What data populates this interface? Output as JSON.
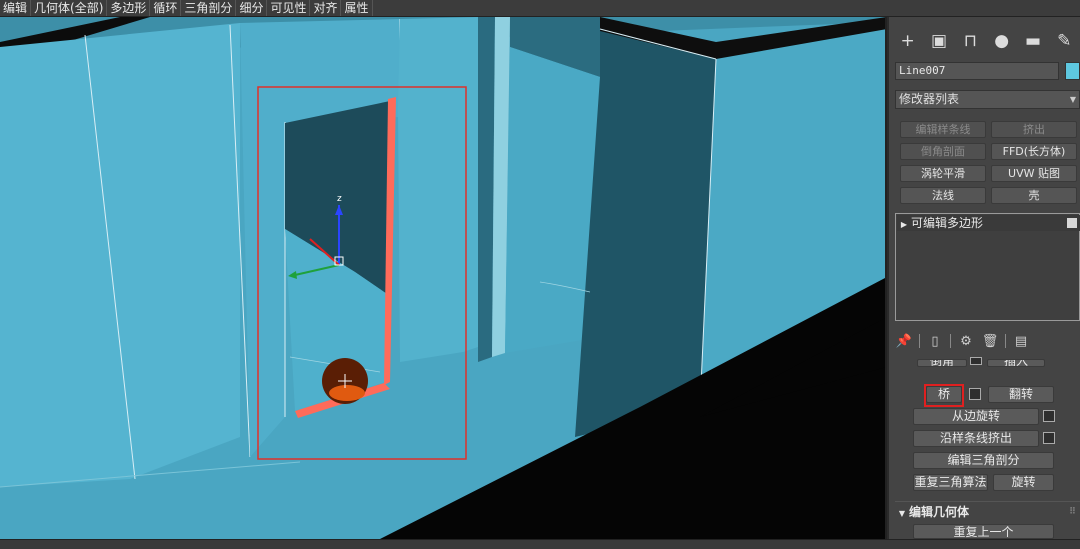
{
  "menu": {
    "items": [
      "编辑",
      "几何体(全部)",
      "多边形",
      "循环",
      "三角剖分",
      "细分",
      "可见性",
      "对齐",
      "属性"
    ]
  },
  "viewport": {
    "gizmo_axis_z": "z"
  },
  "panel": {
    "tabs": [
      {
        "icon": "create-icon",
        "glyph": "+"
      },
      {
        "icon": "modify-icon",
        "glyph": "▣"
      },
      {
        "icon": "hierarchy-icon",
        "glyph": "⊓"
      },
      {
        "icon": "motion-icon",
        "glyph": "●"
      },
      {
        "icon": "display-icon",
        "glyph": "▬"
      },
      {
        "icon": "utilities-icon",
        "glyph": "🔧"
      }
    ],
    "object_name": "Line007",
    "object_color": "#5ec8e0",
    "modifier_list": "修改器列表",
    "modifier_buttons": [
      "编辑样条线",
      "挤出",
      "倒角剖面",
      "FFD(长方体)",
      "涡轮平滑",
      "UVW 贴图",
      "法线",
      "壳"
    ],
    "stack_item": "可编辑多边形",
    "stack_tools": [
      "pin-icon",
      "show-end-result-icon",
      "make-unique-icon",
      "remove-modifier-icon",
      "configure-icon"
    ],
    "rollout": {
      "partial_labels": [
        "倒角",
        "插入"
      ],
      "bridge": "桥",
      "flip": "翻转",
      "hinge_from_edge": "从边旋转",
      "extrude_along_spline": "沿样条线挤出",
      "edit_triangulation": "编辑三角剖分",
      "retriangulate": "重复三角算法",
      "turn": "旋转"
    },
    "edit_geometry_header": "编辑几何体",
    "repeat_last": "重复上一个"
  }
}
